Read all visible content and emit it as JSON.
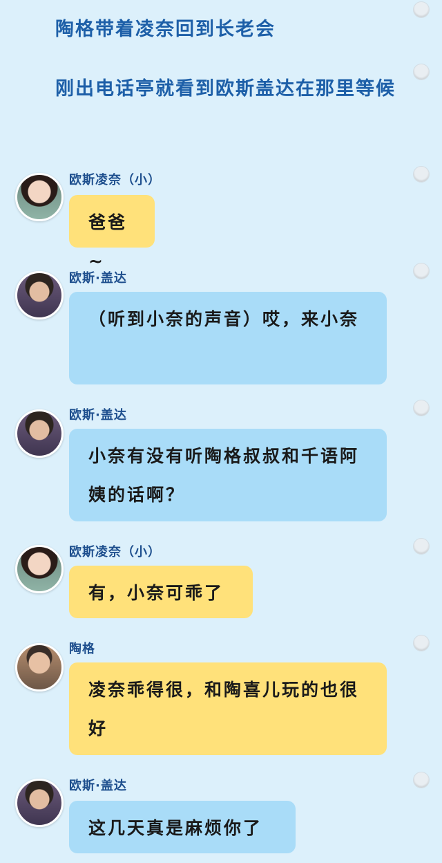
{
  "narration": [
    {
      "text": "陶格带着凌奈回到长老会"
    },
    {
      "text": "刚出电话亭就看到欧斯盖达在那里等候"
    }
  ],
  "messages": [
    {
      "speaker": "欧斯凌奈（小）",
      "text": "爸爸~",
      "bubble_color": "yellow",
      "avatar": "girl-avatar"
    },
    {
      "speaker": "欧斯·盖达",
      "text": "（听到小奈的声音）哎，来小奈",
      "bubble_color": "blue",
      "avatar": "man-avatar"
    },
    {
      "speaker": "欧斯·盖达",
      "text": "小奈有没有听陶格叔叔和千语阿姨的话啊？",
      "bubble_color": "blue",
      "avatar": "man-avatar"
    },
    {
      "speaker": "欧斯凌奈（小）",
      "text": "有，小奈可乖了",
      "bubble_color": "yellow",
      "avatar": "girl-avatar"
    },
    {
      "speaker": "陶格",
      "text": "凌奈乖得很，和陶喜儿玩的也很好",
      "bubble_color": "yellow",
      "avatar": "older-man-avatar"
    },
    {
      "speaker": "欧斯·盖达",
      "text": "这几天真是麻烦你了",
      "bubble_color": "blue",
      "avatar": "man-avatar"
    }
  ],
  "colors": {
    "background": "#dcf0fb",
    "narration_text": "#1d5fa8",
    "speaker_text": "#1e4f8e",
    "bubble_yellow": "#ffe17a",
    "bubble_blue": "#a9dcf8"
  }
}
